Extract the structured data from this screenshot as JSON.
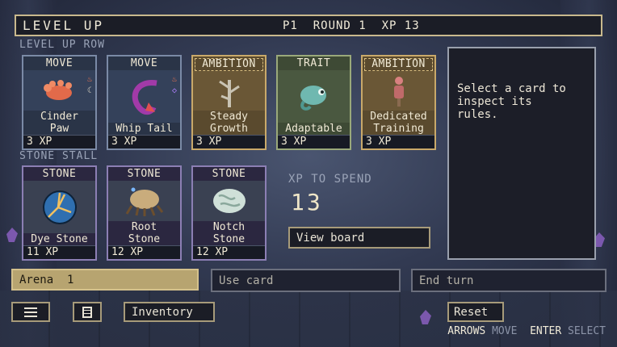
{
  "header": {
    "title": "LEVEL UP",
    "status": "P1  ROUND 1  XP 13"
  },
  "sections": {
    "level_up_row": "LEVEL UP ROW",
    "stone_stall": "STONE STALL"
  },
  "level_up_cards": [
    {
      "type": "MOVE",
      "name_lines": [
        "Cinder",
        "Paw"
      ],
      "cost": "3 XP",
      "kind": "move",
      "art": "paw-icon"
    },
    {
      "type": "MOVE",
      "name_lines": [
        "Whip Tail"
      ],
      "cost": "3 XP",
      "kind": "move",
      "art": "tail-icon"
    },
    {
      "type": "AMBITION",
      "name_lines": [
        "Steady",
        "Growth"
      ],
      "cost": "3 XP",
      "kind": "ambition",
      "art": "sprout-icon"
    },
    {
      "type": "TRAIT",
      "name_lines": [
        "Adaptable"
      ],
      "cost": "3 XP",
      "kind": "trait",
      "art": "chameleon-icon"
    },
    {
      "type": "AMBITION",
      "name_lines": [
        "Dedicated",
        "Training"
      ],
      "cost": "3 XP",
      "kind": "ambition",
      "art": "training-dummy-icon"
    }
  ],
  "stone_cards": [
    {
      "type": "STONE",
      "name_lines": [
        "Dye Stone"
      ],
      "cost": "11 XP",
      "art": "dye-stone-icon"
    },
    {
      "type": "STONE",
      "name_lines": [
        "Root",
        "Stone"
      ],
      "cost": "12 XP",
      "art": "root-stone-icon"
    },
    {
      "type": "STONE",
      "name_lines": [
        "Notch",
        "Stone"
      ],
      "cost": "12 XP",
      "art": "notch-stone-icon"
    }
  ],
  "info_panel": {
    "text_lines": [
      "Select a card to",
      "inspect its",
      "rules."
    ]
  },
  "xp": {
    "label": "XP TO SPEND",
    "value": "13"
  },
  "buttons": {
    "view_board": "View board",
    "arena": "Arena  1",
    "use_card": "Use card",
    "end_turn": "End turn",
    "inventory": "Inventory",
    "reset": "Reset"
  },
  "hints": {
    "arrows": "ARROWS",
    "move": "MOVE",
    "enter": "ENTER",
    "select": "SELECT"
  },
  "colors": {
    "accent_gold": "#c9b98d",
    "arena_fill": "#b7a470",
    "panel_bg": "#1c1e28"
  }
}
